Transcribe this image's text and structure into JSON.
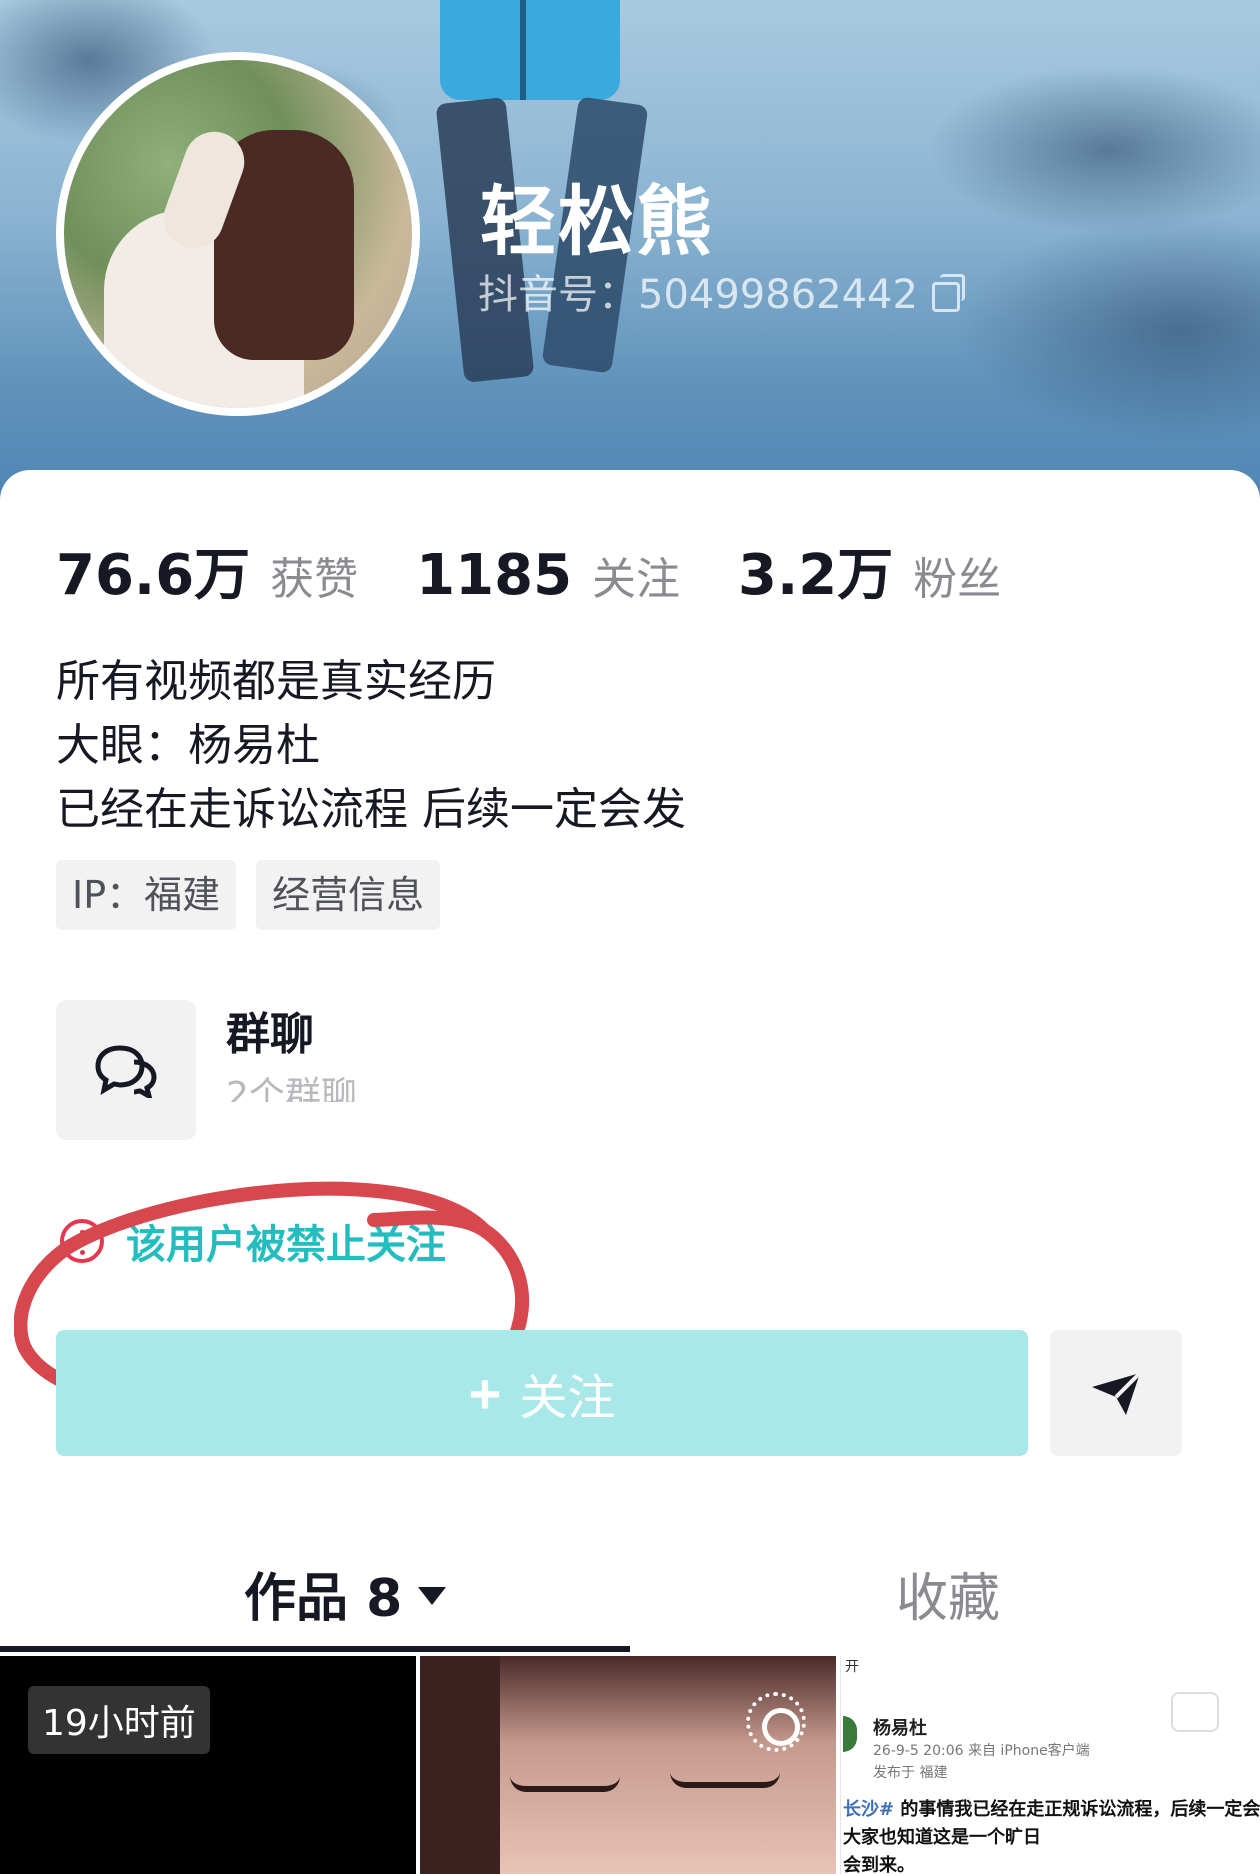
{
  "profile": {
    "username": "轻松熊",
    "douyin_id": "抖音号：50499862442"
  },
  "stats": [
    {
      "value": "76.6万",
      "label": "获赞"
    },
    {
      "value": "1185",
      "label": "关注"
    },
    {
      "value": "3.2万",
      "label": "粉丝"
    }
  ],
  "bio": [
    "所有视频都是真实经历",
    "大眼：杨易杜",
    "已经在走诉讼流程 后续一定会发"
  ],
  "tags": [
    "IP：福建",
    "经营信息"
  ],
  "group_chat": {
    "title": "群聊",
    "subtitle": "2个群聊"
  },
  "warning": {
    "text": "该用户被禁止关注",
    "color": "#23bdbf",
    "icon": "alert-circle-icon"
  },
  "follow_button": {
    "label": "关注",
    "icon": "plus-icon",
    "color": "#a8e8e8"
  },
  "message_button": {
    "icon": "send-icon"
  },
  "tabs": [
    {
      "label": "作品 8",
      "active": true
    },
    {
      "label": "收藏",
      "active": false
    }
  ],
  "grid": {
    "thumb1_badge": "19小时前",
    "thumb3_header": "开",
    "thumb3_name": "杨易杜",
    "thumb3_meta": "26-9-5 20:06  来自 iPhone客户端",
    "thumb3_location": "发布于 福建",
    "thumb3_tag": "长沙#",
    "thumb3_line1": " 的事情我已经在走正规诉讼流程，后续一定会",
    "thumb3_line2": "大家也知道这是一个旷日",
    "thumb3_line3": "会到来。"
  },
  "colors": {
    "banner": "#5f92bb",
    "accent_red": "#e8364f",
    "text_primary": "#161823",
    "text_secondary": "#8a8b91"
  }
}
